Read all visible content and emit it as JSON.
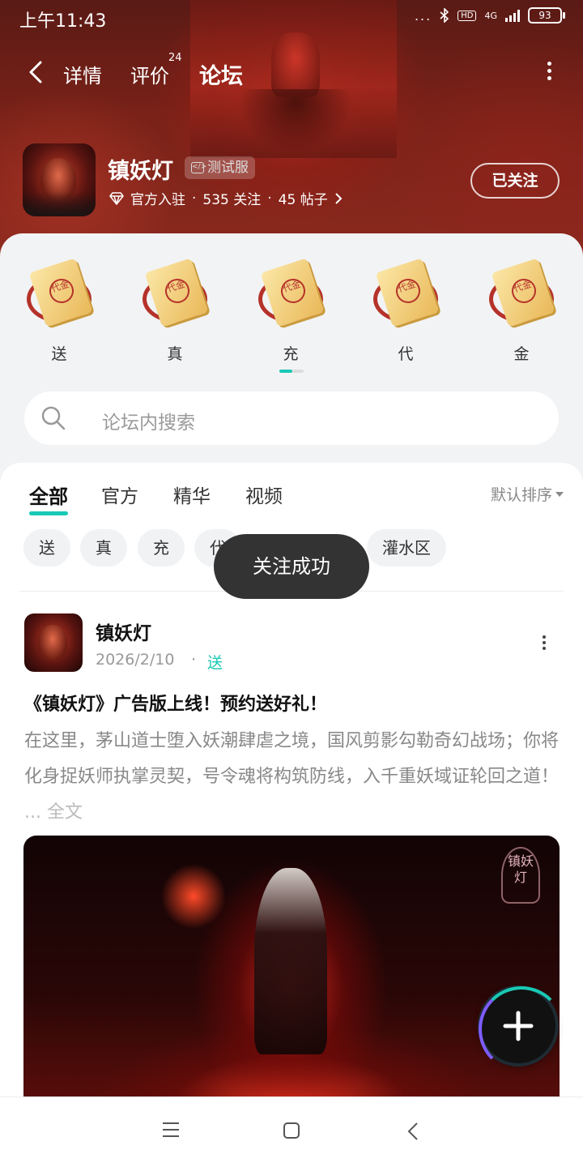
{
  "status_bar": {
    "time": "上午11:43",
    "dots": "...",
    "network": "4G",
    "hd": "HD",
    "battery": "93"
  },
  "nav": {
    "tabs": [
      {
        "label": "详情"
      },
      {
        "label": "评价",
        "badge": "24"
      },
      {
        "label": "论坛",
        "active": true
      }
    ]
  },
  "game": {
    "name": "镇妖灯",
    "badge": "测试服",
    "official": "官方入驻",
    "sep": "·",
    "followers": "535 关注",
    "posts": "45 帖子",
    "follow_button": "已关注"
  },
  "categories": [
    {
      "label": "送",
      "icon": "voucher-icon",
      "seal": "代金"
    },
    {
      "label": "真",
      "icon": "voucher-icon",
      "seal": "代金"
    },
    {
      "label": "充",
      "icon": "voucher-icon",
      "seal": "代金"
    },
    {
      "label": "代",
      "icon": "voucher-icon",
      "seal": "代金"
    },
    {
      "label": "金",
      "icon": "voucher-icon",
      "seal": "代金"
    }
  ],
  "search": {
    "placeholder": "论坛内搜索"
  },
  "feed_tabs": [
    {
      "label": "全部",
      "active": true
    },
    {
      "label": "官方"
    },
    {
      "label": "精华"
    },
    {
      "label": "视频"
    }
  ],
  "sort": {
    "label": "默认排序"
  },
  "chips": [
    "送",
    "真",
    "充",
    "代",
    "灌水区"
  ],
  "toast": "关注成功",
  "post": {
    "author": "镇妖灯",
    "date": "2026/2/10",
    "sep": "·",
    "tag": "送",
    "title": "《镇妖灯》广告版上线！预约送好礼！",
    "body": "在这里，茅山道士堕入妖潮肆虐之境，国风剪影勾勒奇幻战场；你将化身捉妖师执掌灵契，号令魂将构筑防线，入千重妖域证轮回之道！",
    "ellipsis": "...",
    "read_more": "全文",
    "image_logo": "镇妖灯"
  },
  "colors": {
    "accent": "#19c9b5",
    "hero": "#8d2a1f"
  }
}
